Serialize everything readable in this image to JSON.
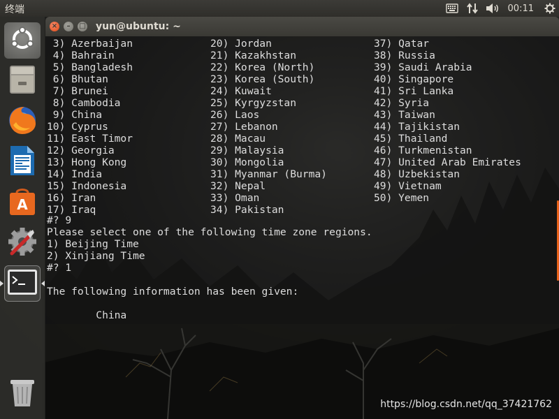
{
  "top_panel": {
    "active_app": "终端",
    "clock": "00:11",
    "indicators": [
      "keyboard-icon",
      "network-icon",
      "volume-icon",
      "settings-gear-icon"
    ]
  },
  "launcher": {
    "items": [
      {
        "name": "ubuntu-dash",
        "icon": "ubuntu-logo-icon"
      },
      {
        "name": "files",
        "icon": "file-cabinet-icon"
      },
      {
        "name": "firefox",
        "icon": "firefox-icon"
      },
      {
        "name": "libreoffice-writer",
        "icon": "writer-document-icon"
      },
      {
        "name": "ubuntu-software",
        "icon": "software-bag-icon"
      },
      {
        "name": "system-settings",
        "icon": "settings-tools-icon"
      },
      {
        "name": "terminal",
        "icon": "terminal-icon",
        "active": true
      },
      {
        "name": "trash",
        "icon": "trash-icon"
      }
    ]
  },
  "window": {
    "title": "yun@ubuntu: ~",
    "accent_color": "#e8621a"
  },
  "terminal": {
    "countries": [
      [
        " 3) Azerbaijan",
        "20) Jordan",
        "37) Qatar"
      ],
      [
        " 4) Bahrain",
        "21) Kazakhstan",
        "38) Russia"
      ],
      [
        " 5) Bangladesh",
        "22) Korea (North)",
        "39) Saudi Arabia"
      ],
      [
        " 6) Bhutan",
        "23) Korea (South)",
        "40) Singapore"
      ],
      [
        " 7) Brunei",
        "24) Kuwait",
        "41) Sri Lanka"
      ],
      [
        " 8) Cambodia",
        "25) Kyrgyzstan",
        "42) Syria"
      ],
      [
        " 9) China",
        "26) Laos",
        "43) Taiwan"
      ],
      [
        "10) Cyprus",
        "27) Lebanon",
        "44) Tajikistan"
      ],
      [
        "11) East Timor",
        "28) Macau",
        "45) Thailand"
      ],
      [
        "12) Georgia",
        "29) Malaysia",
        "46) Turkmenistan"
      ],
      [
        "13) Hong Kong",
        "30) Mongolia",
        "47) United Arab Emirates"
      ],
      [
        "14) India",
        "31) Myanmar (Burma)",
        "48) Uzbekistan"
      ],
      [
        "15) Indonesia",
        "32) Nepal",
        "49) Vietnam"
      ],
      [
        "16) Iran",
        "33) Oman",
        "50) Yemen"
      ],
      [
        "17) Iraq",
        "34) Pakistan",
        ""
      ]
    ],
    "prompt1": "#? 9",
    "question": "Please select one of the following time zone regions.",
    "option1": "1) Beijing Time",
    "option2": "2) Xinjiang Time",
    "prompt2": "#? 1",
    "blank": "",
    "info": "The following information has been given:",
    "blank2": "",
    "given_country": "        China"
  },
  "watermark": "https://blog.csdn.net/qq_37421762"
}
